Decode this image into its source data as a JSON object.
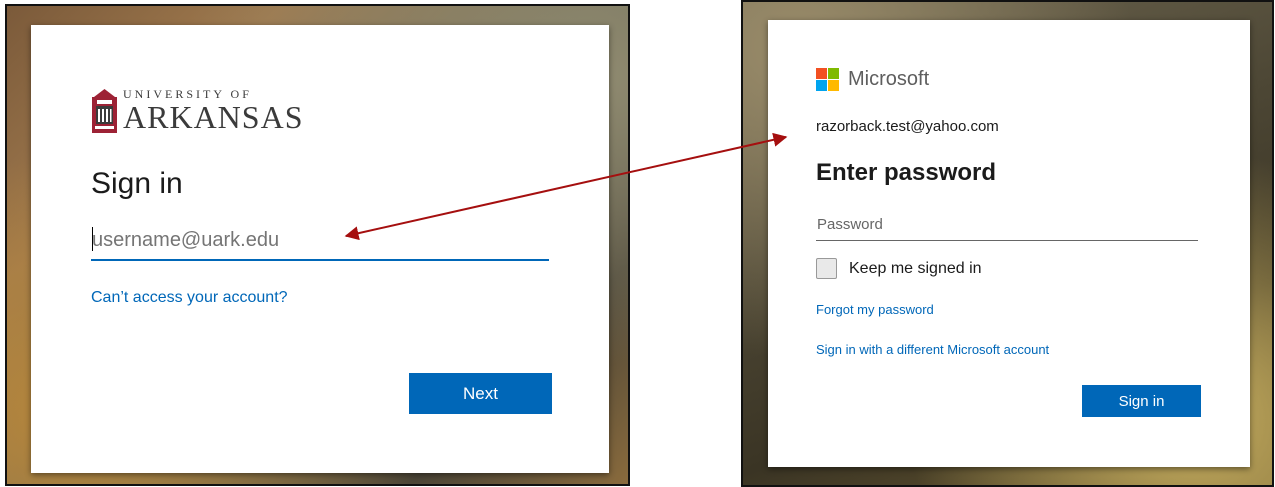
{
  "uark": {
    "logo_top": "UNIVERSITY OF",
    "logo_main": "ARKANSAS",
    "title": "Sign in",
    "username_placeholder": "username@uark.edu",
    "cant_access_link": "Can’t access your account?",
    "next_button": "Next",
    "crest_color": "#9d2235"
  },
  "microsoft": {
    "brand": "Microsoft",
    "email": "razorback.test@yahoo.com",
    "title": "Enter password",
    "password_placeholder": "Password",
    "keep_signed_in_label": "Keep me signed in",
    "forgot_link": "Forgot my password",
    "different_account_link": "Sign in with a different Microsoft account",
    "signin_button": "Sign in",
    "logo_colors": [
      "#f25022",
      "#7fba00",
      "#00a4ef",
      "#ffb900"
    ]
  },
  "colors": {
    "accent": "#0067b8",
    "arrow": "#a50f0f"
  }
}
